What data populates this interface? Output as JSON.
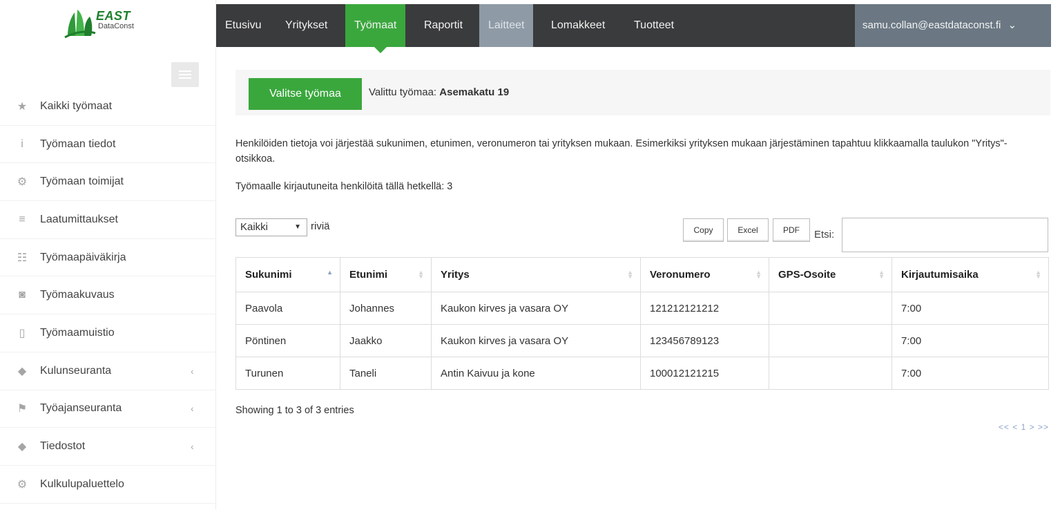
{
  "logo": {
    "title": "EAST",
    "subtitle": "DataConst"
  },
  "sidebar": {
    "items": [
      {
        "label": "Kaikki työmaat",
        "icon": "star-icon",
        "glyph": "★"
      },
      {
        "label": "Työmaan tiedot",
        "icon": "info-icon",
        "glyph": "i"
      },
      {
        "label": "Työmaan toimijat",
        "icon": "gears-icon",
        "glyph": "⚙"
      },
      {
        "label": "Laatumittaukset",
        "icon": "lines-icon",
        "glyph": "≡"
      },
      {
        "label": "Työmaapäiväkirja",
        "icon": "list-icon",
        "glyph": "☷"
      },
      {
        "label": "Työmaakuvaus",
        "icon": "camera-icon",
        "glyph": "◙"
      },
      {
        "label": "Työmaamuistio",
        "icon": "file-icon",
        "glyph": "▯"
      },
      {
        "label": "Kulunseuranta",
        "icon": "tags-icon",
        "glyph": "◆",
        "chevron": "‹"
      },
      {
        "label": "Työajanseuranta",
        "icon": "flag-icon",
        "glyph": "⚑",
        "chevron": "‹"
      },
      {
        "label": "Tiedostot",
        "icon": "tags-icon",
        "glyph": "◆",
        "chevron": "‹"
      },
      {
        "label": "Kulkulupaluettelo",
        "icon": "gears-icon",
        "glyph": "⚙"
      }
    ]
  },
  "topnav": {
    "items": [
      {
        "label": "Etusivu"
      },
      {
        "label": "Yritykset"
      },
      {
        "label": "Työmaat"
      },
      {
        "label": "Raportit"
      },
      {
        "label": "Laitteet"
      },
      {
        "label": "Lomakkeet"
      },
      {
        "label": "Tuotteet"
      }
    ],
    "user": "samu.collan@eastdataconst.fi",
    "user_chevron": "⌄"
  },
  "site": {
    "button_label": "Valitse työmaa",
    "selected_prefix": "Valittu työmaa:",
    "selected_name": "Asemakatu 19"
  },
  "info_text": "Henkilöiden tietoja voi järjestää sukunimen, etunimen, veronumeron tai yrityksen mukaan. Esimerkiksi yrityksen mukaan järjestäminen tapahtuu klikkaamalla taulukon \"Yritys\"-otsikkoa.",
  "logged_in_text": "Työmaalle kirjautuneita henkilöitä tällä hetkellä: 3",
  "controls": {
    "rows_value": "Kaikki",
    "rows_arrow": "▼",
    "rows_label": "riviä",
    "copy": "Copy",
    "excel": "Excel",
    "pdf": "PDF",
    "search_label": "Etsi:"
  },
  "table": {
    "sort_up": "▲",
    "sort_down": "▼",
    "headers": [
      "Sukunimi",
      "Etunimi",
      "Yritys",
      "Veronumero",
      "GPS-Osoite",
      "Kirjautumisaika"
    ],
    "rows": [
      [
        "Paavola",
        "Johannes",
        "Kaukon kirves ja vasara OY",
        "121212121212",
        "",
        "7:00"
      ],
      [
        "Pöntinen",
        "Jaakko",
        "Kaukon kirves ja vasara OY",
        "123456789123",
        "",
        "7:00"
      ],
      [
        "Turunen",
        "Taneli",
        "Antin Kaivuu ja kone",
        "100012121215",
        "",
        "7:00"
      ]
    ]
  },
  "showing": "Showing 1 to 3 of 3 entries",
  "pager": {
    "first": "<<",
    "prev": "<",
    "page": "1",
    "next": ">",
    "last": ">>"
  },
  "colors": {
    "accent_green": "#3aa73d",
    "topbar_dark": "#3a3b3c",
    "user_menu": "#6b7884",
    "dimmed_tab": "#8e9aa6"
  }
}
